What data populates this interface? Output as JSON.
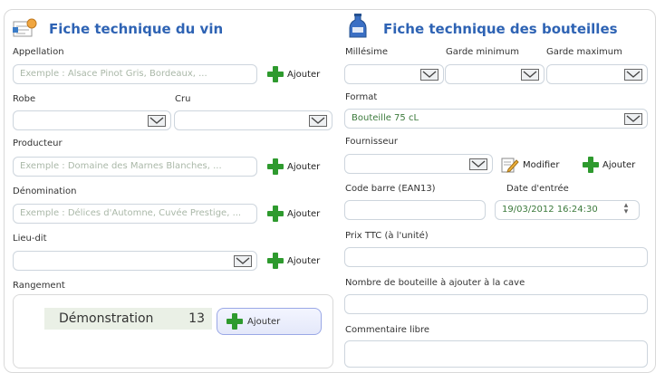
{
  "wine_sheet": {
    "title": "Fiche technique du vin",
    "appellation_label": "Appellation",
    "appellation_placeholder": "Exemple : Alsace Pinot Gris, Bordeaux, ...",
    "robe_label": "Robe",
    "cru_label": "Cru",
    "producteur_label": "Producteur",
    "producteur_placeholder": "Exemple : Domaine des Marnes Blanches, ...",
    "denomination_label": "Dénomination",
    "denomination_placeholder": "Exemple : Délices d'Automne, Cuvée Prestige, ...",
    "lieu_dit_label": "Lieu-dit",
    "rangement_label": "Rangement",
    "add_label": "Ajouter",
    "storage": {
      "name": "Démonstration",
      "count": "13",
      "add_label": "Ajouter"
    }
  },
  "bottle_sheet": {
    "title": "Fiche technique des bouteilles",
    "millesime_label": "Millésime",
    "garde_min_label": "Garde minimum",
    "garde_max_label": "Garde maximum",
    "format_label": "Format",
    "format_value": "Bouteille 75 cL",
    "fournisseur_label": "Fournisseur",
    "modifier_label": "Modifier",
    "add_label": "Ajouter",
    "code_barre_label": "Code barre (EAN13)",
    "date_entree_label": "Date d'entrée",
    "date_entree_value": "19/03/2012 16:24:30",
    "prix_label": "Prix TTC (à l'unité)",
    "nombre_label": "Nombre de bouteille à ajouter à la cave",
    "commentaire_label": "Commentaire libre"
  },
  "colors": {
    "title": "#2e63b4",
    "plus": "#2e9a2e",
    "field_border": "#cdd5dd"
  }
}
